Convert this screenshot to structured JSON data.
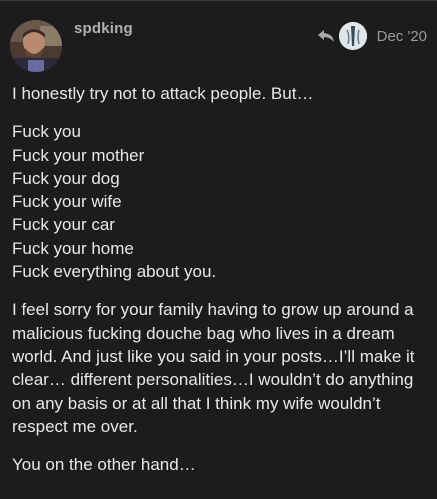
{
  "post": {
    "username": "spdking",
    "date": "Dec '20",
    "opening": "I honestly try not to attack people. But…",
    "list_lines": [
      "Fuck you",
      "Fuck your mother",
      "Fuck your dog",
      "Fuck your wife",
      "Fuck your car",
      "Fuck your home",
      "Fuck everything about you."
    ],
    "paragraph": "I feel sorry for your family having to grow up around a malicious fucking douche bag who lives in a dream world. And just like you said in your posts…I’ll make it clear… different personalities…I wouldn’t do anything on any basis or at all that I think my wife wouldn’t respect me over.",
    "closing": "You on the other hand…"
  },
  "icons": {
    "author_avatar": "user-avatar-photo",
    "reply_indicator": "reply-arrow-icon",
    "reply_to_avatar": "reply-to-user-avatar"
  },
  "colors": {
    "background": "#1c1c1c",
    "text": "#e8e8e8",
    "username": "#b0b0b0",
    "date": "#9a9a9a"
  }
}
